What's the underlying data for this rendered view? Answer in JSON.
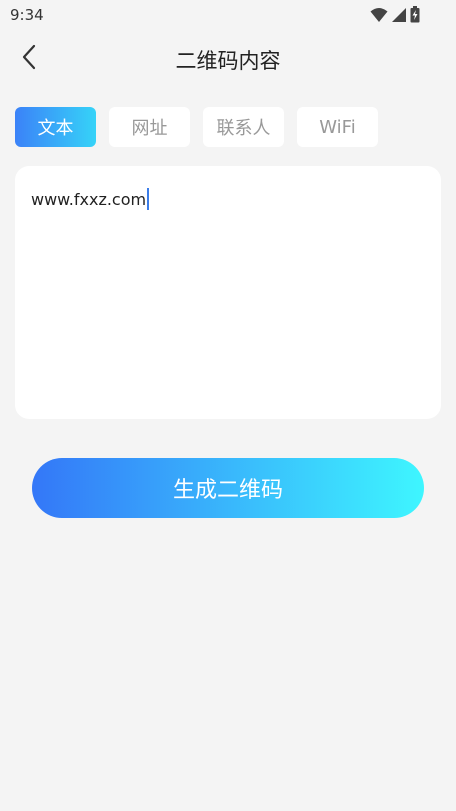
{
  "status_bar": {
    "time": "9:34",
    "icons": [
      "wifi-icon",
      "signal-icon",
      "battery-charging-icon"
    ]
  },
  "header": {
    "title": "二维码内容",
    "back_icon": "chevron-left-icon"
  },
  "tabs": [
    {
      "label": "文本",
      "active": true
    },
    {
      "label": "网址",
      "active": false
    },
    {
      "label": "联系人",
      "active": false
    },
    {
      "label": "WiFi",
      "active": false
    }
  ],
  "content": {
    "text_value": "www.fxxz.com"
  },
  "generate_button": {
    "label": "生成二维码"
  },
  "colors": {
    "background": "#f4f4f4",
    "accent_start": "#3477f8",
    "accent_end": "#3ef6ff",
    "caret": "#3b7de9"
  }
}
